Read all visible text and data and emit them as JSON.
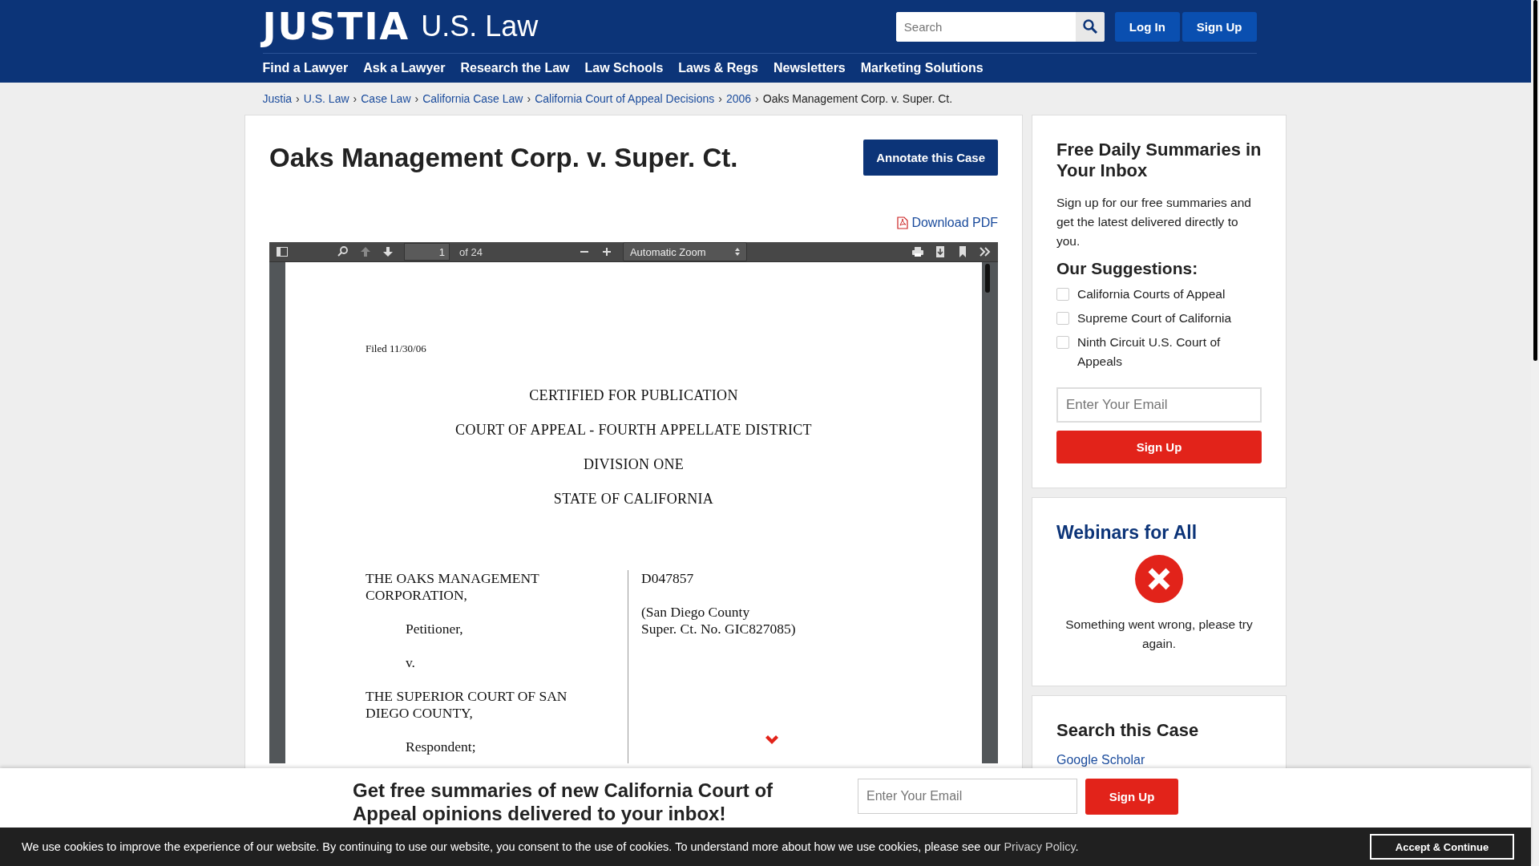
{
  "header": {
    "logo": "JUSTIA",
    "logo_suffix": "U.S. Law",
    "search": {
      "placeholder": "Search"
    },
    "buttons": [
      "Log In",
      "Sign Up"
    ],
    "nav": [
      "Find a Lawyer",
      "Ask a Lawyer",
      "Research the Law",
      "Law Schools",
      "Laws & Regs",
      "Newsletters",
      "Marketing Solutions"
    ]
  },
  "breadcrumb_separator": "›",
  "breadcrumbs": [
    "Justia",
    "U.S. Law",
    "Case Law",
    "California Case Law",
    "California Court of Appeal Decisions",
    "2006",
    "Oaks Management Corp. v. Super. Ct."
  ],
  "case": {
    "title": "Oaks Management Corp. v. Super. Ct.",
    "annotate_button": "Annotate this Case",
    "download": "Download PDF"
  },
  "pdf_viewer": {
    "page_number": "1",
    "page_count": "of 24",
    "zoom": "Automatic Zoom",
    "page": {
      "filed": "Filed 11/30/06",
      "headings": [
        "CERTIFIED FOR PUBLICATION",
        "COURT OF APPEAL - FOURTH APPELLATE DISTRICT",
        "DIVISION ONE",
        "STATE OF CALIFORNIA"
      ],
      "left_column": [
        {
          "kind": "party",
          "text": "THE OAKS MANAGEMENT CORPORATION,"
        },
        {
          "kind": "role",
          "text": "Petitioner,"
        },
        {
          "kind": "role",
          "text": "v."
        },
        {
          "kind": "party",
          "text": "THE SUPERIOR COURT OF SAN DIEGO COUNTY,"
        },
        {
          "kind": "role",
          "text": "Respondent;"
        }
      ],
      "right_column": [
        "D047857",
        "(San Diego County\nSuper. Ct. No. GIC827085)"
      ]
    }
  },
  "sidebar": {
    "summaries": {
      "title": "Free Daily Summaries in Your Inbox",
      "text": "Sign up for our free summaries and get the latest delivered directly to you.",
      "suggestions_title": "Our Suggestions:",
      "suggestions": [
        {
          "label": "California Courts of Appeal",
          "checked": false
        },
        {
          "label": "Supreme Court of California",
          "checked": false
        },
        {
          "label": "Ninth Circuit U.S. Court of Appeals",
          "checked": false
        }
      ],
      "email": {
        "placeholder": "Enter Your Email"
      },
      "button": "Sign Up"
    },
    "webinars": {
      "title": "Webinars for All",
      "error": "Something went wrong, please try again."
    },
    "search_case": {
      "title": "Search this Case",
      "links": [
        "Google Scholar"
      ]
    }
  },
  "newsletter_bar": {
    "heading": "Get free summaries of new California Court of Appeal opinions delivered to your inbox!",
    "email": {
      "placeholder": "Enter Your Email"
    },
    "button": "Sign Up"
  },
  "cookie_bar": {
    "text": "We use cookies to improve the experience of our website. By continuing to use our website, you consent to the use of cookies. To understand more about how we use cookies, please see our ",
    "link": "Privacy Policy",
    "end": ".",
    "button": "Accept & Continue"
  }
}
